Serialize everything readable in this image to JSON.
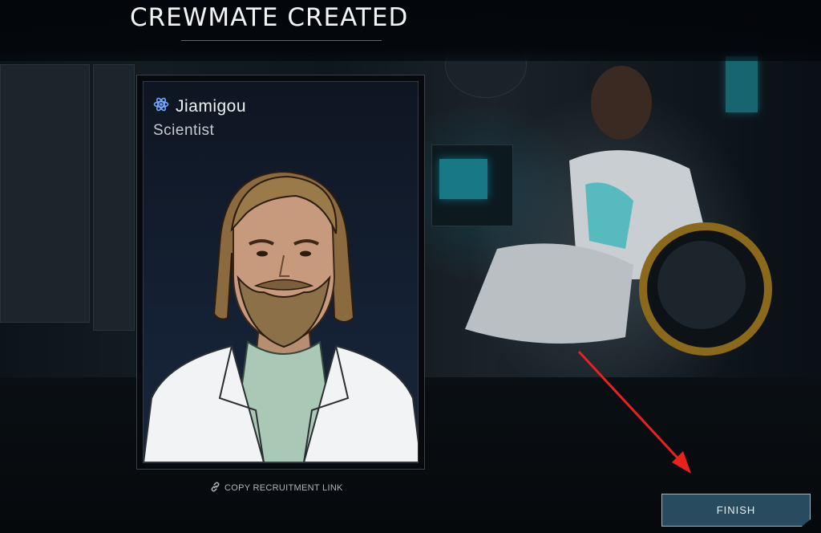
{
  "header": {
    "title": "CREWMATE CREATED"
  },
  "crewmate": {
    "name": "Jiamigou",
    "role": "Scientist",
    "role_icon": "atom-icon"
  },
  "actions": {
    "copy_link_label": "COPY RECRUITMENT LINK",
    "copy_link_icon": "link-icon",
    "finish_label": "FINISH"
  },
  "colors": {
    "accent": "#294b5f",
    "annotation_arrow": "#e8231e"
  }
}
